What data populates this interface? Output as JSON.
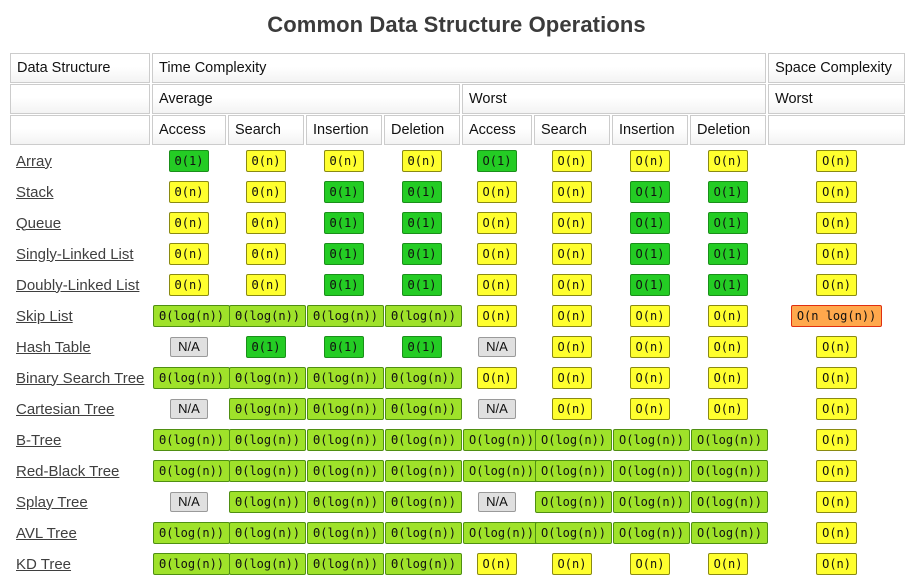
{
  "page": {
    "title": "Common Data Structure Operations"
  },
  "table": {
    "header_row1": [
      "Data Structure",
      "Time Complexity",
      "Space Complexity"
    ],
    "header_row2": [
      "",
      "Average",
      "Worst",
      "Worst"
    ],
    "header_row3": [
      "",
      "Access",
      "Search",
      "Insertion",
      "Deletion",
      "Access",
      "Search",
      "Insertion",
      "Deletion",
      ""
    ],
    "rows": [
      {
        "name": "Array",
        "cells": [
          {
            "text": "Θ(1)",
            "kind": "constant"
          },
          {
            "text": "Θ(n)",
            "kind": "linear"
          },
          {
            "text": "Θ(n)",
            "kind": "linear"
          },
          {
            "text": "Θ(n)",
            "kind": "linear"
          },
          {
            "text": "O(1)",
            "kind": "constant"
          },
          {
            "text": "O(n)",
            "kind": "linear"
          },
          {
            "text": "O(n)",
            "kind": "linear"
          },
          {
            "text": "O(n)",
            "kind": "linear"
          },
          {
            "text": "O(n)",
            "kind": "linear"
          }
        ]
      },
      {
        "name": "Stack",
        "cells": [
          {
            "text": "Θ(n)",
            "kind": "linear"
          },
          {
            "text": "Θ(n)",
            "kind": "linear"
          },
          {
            "text": "Θ(1)",
            "kind": "constant"
          },
          {
            "text": "Θ(1)",
            "kind": "constant"
          },
          {
            "text": "O(n)",
            "kind": "linear"
          },
          {
            "text": "O(n)",
            "kind": "linear"
          },
          {
            "text": "O(1)",
            "kind": "constant"
          },
          {
            "text": "O(1)",
            "kind": "constant"
          },
          {
            "text": "O(n)",
            "kind": "linear"
          }
        ]
      },
      {
        "name": "Queue",
        "cells": [
          {
            "text": "Θ(n)",
            "kind": "linear"
          },
          {
            "text": "Θ(n)",
            "kind": "linear"
          },
          {
            "text": "Θ(1)",
            "kind": "constant"
          },
          {
            "text": "Θ(1)",
            "kind": "constant"
          },
          {
            "text": "O(n)",
            "kind": "linear"
          },
          {
            "text": "O(n)",
            "kind": "linear"
          },
          {
            "text": "O(1)",
            "kind": "constant"
          },
          {
            "text": "O(1)",
            "kind": "constant"
          },
          {
            "text": "O(n)",
            "kind": "linear"
          }
        ]
      },
      {
        "name": "Singly-Linked List",
        "cells": [
          {
            "text": "Θ(n)",
            "kind": "linear"
          },
          {
            "text": "Θ(n)",
            "kind": "linear"
          },
          {
            "text": "Θ(1)",
            "kind": "constant"
          },
          {
            "text": "Θ(1)",
            "kind": "constant"
          },
          {
            "text": "O(n)",
            "kind": "linear"
          },
          {
            "text": "O(n)",
            "kind": "linear"
          },
          {
            "text": "O(1)",
            "kind": "constant"
          },
          {
            "text": "O(1)",
            "kind": "constant"
          },
          {
            "text": "O(n)",
            "kind": "linear"
          }
        ]
      },
      {
        "name": "Doubly-Linked List",
        "cells": [
          {
            "text": "Θ(n)",
            "kind": "linear"
          },
          {
            "text": "Θ(n)",
            "kind": "linear"
          },
          {
            "text": "Θ(1)",
            "kind": "constant"
          },
          {
            "text": "Θ(1)",
            "kind": "constant"
          },
          {
            "text": "O(n)",
            "kind": "linear"
          },
          {
            "text": "O(n)",
            "kind": "linear"
          },
          {
            "text": "O(1)",
            "kind": "constant"
          },
          {
            "text": "O(1)",
            "kind": "constant"
          },
          {
            "text": "O(n)",
            "kind": "linear"
          }
        ]
      },
      {
        "name": "Skip List",
        "cells": [
          {
            "text": "Θ(log(n))",
            "kind": "log"
          },
          {
            "text": "Θ(log(n))",
            "kind": "log"
          },
          {
            "text": "Θ(log(n))",
            "kind": "log"
          },
          {
            "text": "Θ(log(n))",
            "kind": "log"
          },
          {
            "text": "O(n)",
            "kind": "linear"
          },
          {
            "text": "O(n)",
            "kind": "linear"
          },
          {
            "text": "O(n)",
            "kind": "linear"
          },
          {
            "text": "O(n)",
            "kind": "linear"
          },
          {
            "text": "O(n log(n))",
            "kind": "nlogn"
          }
        ]
      },
      {
        "name": "Hash Table",
        "cells": [
          {
            "text": "N/A",
            "kind": "na"
          },
          {
            "text": "Θ(1)",
            "kind": "constant"
          },
          {
            "text": "Θ(1)",
            "kind": "constant"
          },
          {
            "text": "Θ(1)",
            "kind": "constant"
          },
          {
            "text": "N/A",
            "kind": "na"
          },
          {
            "text": "O(n)",
            "kind": "linear"
          },
          {
            "text": "O(n)",
            "kind": "linear"
          },
          {
            "text": "O(n)",
            "kind": "linear"
          },
          {
            "text": "O(n)",
            "kind": "linear"
          }
        ]
      },
      {
        "name": "Binary Search Tree",
        "cells": [
          {
            "text": "Θ(log(n))",
            "kind": "log"
          },
          {
            "text": "Θ(log(n))",
            "kind": "log"
          },
          {
            "text": "Θ(log(n))",
            "kind": "log"
          },
          {
            "text": "Θ(log(n))",
            "kind": "log"
          },
          {
            "text": "O(n)",
            "kind": "linear"
          },
          {
            "text": "O(n)",
            "kind": "linear"
          },
          {
            "text": "O(n)",
            "kind": "linear"
          },
          {
            "text": "O(n)",
            "kind": "linear"
          },
          {
            "text": "O(n)",
            "kind": "linear"
          }
        ]
      },
      {
        "name": "Cartesian Tree",
        "cells": [
          {
            "text": "N/A",
            "kind": "na"
          },
          {
            "text": "Θ(log(n))",
            "kind": "log"
          },
          {
            "text": "Θ(log(n))",
            "kind": "log"
          },
          {
            "text": "Θ(log(n))",
            "kind": "log"
          },
          {
            "text": "N/A",
            "kind": "na"
          },
          {
            "text": "O(n)",
            "kind": "linear"
          },
          {
            "text": "O(n)",
            "kind": "linear"
          },
          {
            "text": "O(n)",
            "kind": "linear"
          },
          {
            "text": "O(n)",
            "kind": "linear"
          }
        ]
      },
      {
        "name": "B-Tree",
        "cells": [
          {
            "text": "Θ(log(n))",
            "kind": "log"
          },
          {
            "text": "Θ(log(n))",
            "kind": "log"
          },
          {
            "text": "Θ(log(n))",
            "kind": "log"
          },
          {
            "text": "Θ(log(n))",
            "kind": "log"
          },
          {
            "text": "O(log(n))",
            "kind": "log"
          },
          {
            "text": "O(log(n))",
            "kind": "log"
          },
          {
            "text": "O(log(n))",
            "kind": "log"
          },
          {
            "text": "O(log(n))",
            "kind": "log"
          },
          {
            "text": "O(n)",
            "kind": "linear"
          }
        ]
      },
      {
        "name": "Red-Black Tree",
        "cells": [
          {
            "text": "Θ(log(n))",
            "kind": "log"
          },
          {
            "text": "Θ(log(n))",
            "kind": "log"
          },
          {
            "text": "Θ(log(n))",
            "kind": "log"
          },
          {
            "text": "Θ(log(n))",
            "kind": "log"
          },
          {
            "text": "O(log(n))",
            "kind": "log"
          },
          {
            "text": "O(log(n))",
            "kind": "log"
          },
          {
            "text": "O(log(n))",
            "kind": "log"
          },
          {
            "text": "O(log(n))",
            "kind": "log"
          },
          {
            "text": "O(n)",
            "kind": "linear"
          }
        ]
      },
      {
        "name": "Splay Tree",
        "cells": [
          {
            "text": "N/A",
            "kind": "na"
          },
          {
            "text": "Θ(log(n))",
            "kind": "log"
          },
          {
            "text": "Θ(log(n))",
            "kind": "log"
          },
          {
            "text": "Θ(log(n))",
            "kind": "log"
          },
          {
            "text": "N/A",
            "kind": "na"
          },
          {
            "text": "O(log(n))",
            "kind": "log"
          },
          {
            "text": "O(log(n))",
            "kind": "log"
          },
          {
            "text": "O(log(n))",
            "kind": "log"
          },
          {
            "text": "O(n)",
            "kind": "linear"
          }
        ]
      },
      {
        "name": "AVL Tree",
        "cells": [
          {
            "text": "Θ(log(n))",
            "kind": "log"
          },
          {
            "text": "Θ(log(n))",
            "kind": "log"
          },
          {
            "text": "Θ(log(n))",
            "kind": "log"
          },
          {
            "text": "Θ(log(n))",
            "kind": "log"
          },
          {
            "text": "O(log(n))",
            "kind": "log"
          },
          {
            "text": "O(log(n))",
            "kind": "log"
          },
          {
            "text": "O(log(n))",
            "kind": "log"
          },
          {
            "text": "O(log(n))",
            "kind": "log"
          },
          {
            "text": "O(n)",
            "kind": "linear"
          }
        ]
      },
      {
        "name": "KD Tree",
        "cells": [
          {
            "text": "Θ(log(n))",
            "kind": "log"
          },
          {
            "text": "Θ(log(n))",
            "kind": "log"
          },
          {
            "text": "Θ(log(n))",
            "kind": "log"
          },
          {
            "text": "Θ(log(n))",
            "kind": "log"
          },
          {
            "text": "O(n)",
            "kind": "linear"
          },
          {
            "text": "O(n)",
            "kind": "linear"
          },
          {
            "text": "O(n)",
            "kind": "linear"
          },
          {
            "text": "O(n)",
            "kind": "linear"
          },
          {
            "text": "O(n)",
            "kind": "linear"
          }
        ]
      }
    ]
  },
  "colors": {
    "constant": "#24cc24",
    "log": "#9fe22a",
    "linear": "#ffff2e",
    "nlogn": "#ffa84c",
    "na": "#e0e0e0",
    "title": "#3b3b3b"
  }
}
